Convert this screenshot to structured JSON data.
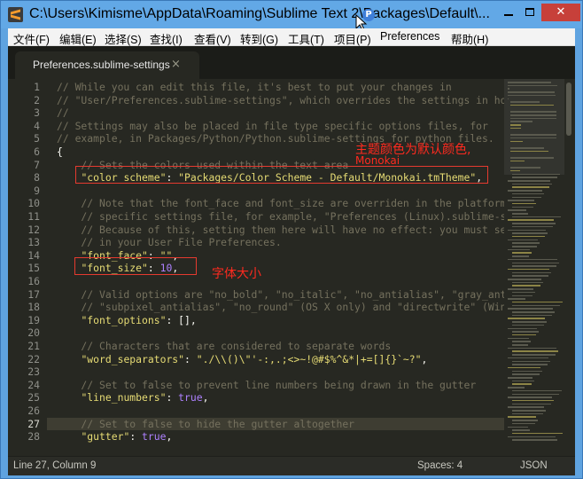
{
  "window": {
    "title": "C:\\Users\\Kimisme\\AppData\\Roaming\\Sublime Text 2\\Packages\\Default\\..."
  },
  "menu": [
    "文件(F)",
    "编辑(E)",
    "选择(S)",
    "查找(I)",
    "查看(V)",
    "转到(G)",
    "工具(T)",
    "项目(P)",
    "Preferences",
    "帮助(H)"
  ],
  "tab": {
    "label": "Preferences.sublime-settings",
    "close": "×"
  },
  "code_lines": [
    [
      [
        "c-comment",
        "// While you can edit this file, it's best to put your changes in"
      ]
    ],
    [
      [
        "c-comment",
        "// \"User/Preferences.sublime-settings\", which overrides the settings in ho"
      ]
    ],
    [
      [
        "c-comment",
        "//"
      ]
    ],
    [
      [
        "c-comment",
        "// Settings may also be placed in file type specific options files, for"
      ]
    ],
    [
      [
        "c-comment",
        "// example, in Packages/Python/Python.sublime-settings for python files."
      ]
    ],
    [
      [
        "c-plain",
        "{"
      ]
    ],
    [
      [
        "c-comment",
        "    // Sets the colors used within the text area"
      ]
    ],
    [
      [
        "c-plain",
        "    "
      ],
      [
        "c-string",
        "\"color_scheme\""
      ],
      [
        "c-plain",
        ": "
      ],
      [
        "c-string",
        "\"Packages/Color Scheme - Default/Monokai.tmTheme\""
      ],
      [
        "c-plain",
        ","
      ]
    ],
    [
      [
        "c-plain",
        ""
      ]
    ],
    [
      [
        "c-comment",
        "    // Note that the font_face and font_size are overriden in the platform"
      ]
    ],
    [
      [
        "c-comment",
        "    // specific settings file, for example, \"Preferences (Linux).sublime-s"
      ]
    ],
    [
      [
        "c-comment",
        "    // Because of this, setting them here will have no effect: you must se"
      ]
    ],
    [
      [
        "c-comment",
        "    // in your User File Preferences."
      ]
    ],
    [
      [
        "c-plain",
        "    "
      ],
      [
        "c-string",
        "\"font_face\""
      ],
      [
        "c-plain",
        ": "
      ],
      [
        "c-string",
        "\"\""
      ],
      [
        "c-plain",
        ","
      ]
    ],
    [
      [
        "c-plain",
        "    "
      ],
      [
        "c-string",
        "\"font_size\""
      ],
      [
        "c-plain",
        ": "
      ],
      [
        "c-number",
        "10"
      ],
      [
        "c-plain",
        ","
      ]
    ],
    [
      [
        "c-plain",
        ""
      ]
    ],
    [
      [
        "c-comment",
        "    // Valid options are \"no_bold\", \"no_italic\", \"no_antialias\", \"gray_ant"
      ]
    ],
    [
      [
        "c-comment",
        "    // \"subpixel_antialias\", \"no_round\" (OS X only) and \"directwrite\" (Win"
      ]
    ],
    [
      [
        "c-plain",
        "    "
      ],
      [
        "c-string",
        "\"font_options\""
      ],
      [
        "c-plain",
        ": [],"
      ]
    ],
    [
      [
        "c-plain",
        ""
      ]
    ],
    [
      [
        "c-comment",
        "    // Characters that are considered to separate words"
      ]
    ],
    [
      [
        "c-plain",
        "    "
      ],
      [
        "c-string",
        "\"word_separators\""
      ],
      [
        "c-plain",
        ": "
      ],
      [
        "c-string",
        "\"./\\\\()\\\"'-:,.;<>~!@#$%^&*|+=[]{}`~?\""
      ],
      [
        "c-plain",
        ","
      ]
    ],
    [
      [
        "c-plain",
        ""
      ]
    ],
    [
      [
        "c-comment",
        "    // Set to false to prevent line numbers being drawn in the gutter"
      ]
    ],
    [
      [
        "c-plain",
        "    "
      ],
      [
        "c-string",
        "\"line_numbers\""
      ],
      [
        "c-plain",
        ": "
      ],
      [
        "c-const",
        "true"
      ],
      [
        "c-plain",
        ","
      ]
    ],
    [
      [
        "c-plain",
        ""
      ]
    ],
    [
      [
        "c-comment",
        "    // Set to false to hide the gutter altogether"
      ]
    ],
    [
      [
        "c-plain",
        "    "
      ],
      [
        "c-string",
        "\"gutter\""
      ],
      [
        "c-plain",
        ": "
      ],
      [
        "c-const",
        "true"
      ],
      [
        "c-plain",
        ","
      ]
    ]
  ],
  "current_line": 27,
  "annotations": {
    "theme_note_line1": "主题颜色为默认颜色,",
    "theme_note_line2": "Monokai",
    "font_size_note": "字体大小"
  },
  "status": {
    "position": "Line 27, Column 9",
    "spaces": "Spaces: 4",
    "syntax": "JSON"
  },
  "colors": {
    "accent_annotation": "#e53a2f",
    "editor_bg": "#272822",
    "comment": "#75715e",
    "string": "#e6db74",
    "number": "#ae81ff"
  }
}
